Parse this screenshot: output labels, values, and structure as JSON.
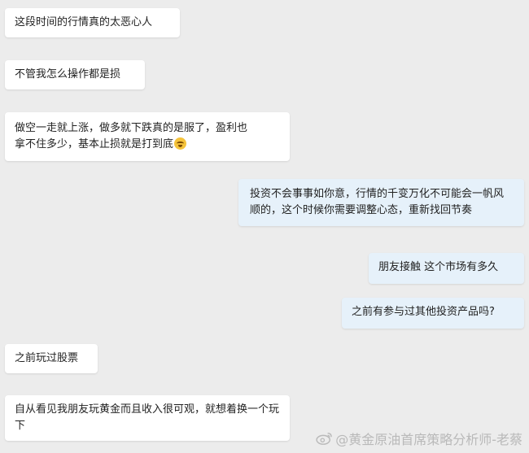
{
  "messages": [
    {
      "side": "left",
      "text": "这段时间的行情真的太恶心人"
    },
    {
      "side": "left",
      "text": "不管我怎么操作都是损"
    },
    {
      "side": "left",
      "text_line1": "做空一走就上涨，做多就下跌真的是服了，盈利也",
      "text_line2": "拿不住多少，基本止损就是打到底",
      "emoji": "crying-face-emoji"
    },
    {
      "side": "right",
      "text": "投资不会事事如你意，行情的千变万化不可能会一帆风顺的，这个时候你需要调整心态，重新找回节奏"
    },
    {
      "side": "right",
      "text": "朋友接触 这个市场有多久"
    },
    {
      "side": "right",
      "text": "之前有参与过其他投资产品吗?"
    },
    {
      "side": "left",
      "text": "之前玩过股票"
    },
    {
      "side": "left",
      "text": "自从看见我朋友玩黄金而且收入很可观，就想着换一个玩下"
    }
  ],
  "watermark": {
    "text": "@黄金原油首席策略分析师-老蔡",
    "icon": "weibo-icon"
  },
  "colors": {
    "background": "#ececec",
    "left_bubble": "#ffffff",
    "right_bubble": "#e6f1fa"
  }
}
